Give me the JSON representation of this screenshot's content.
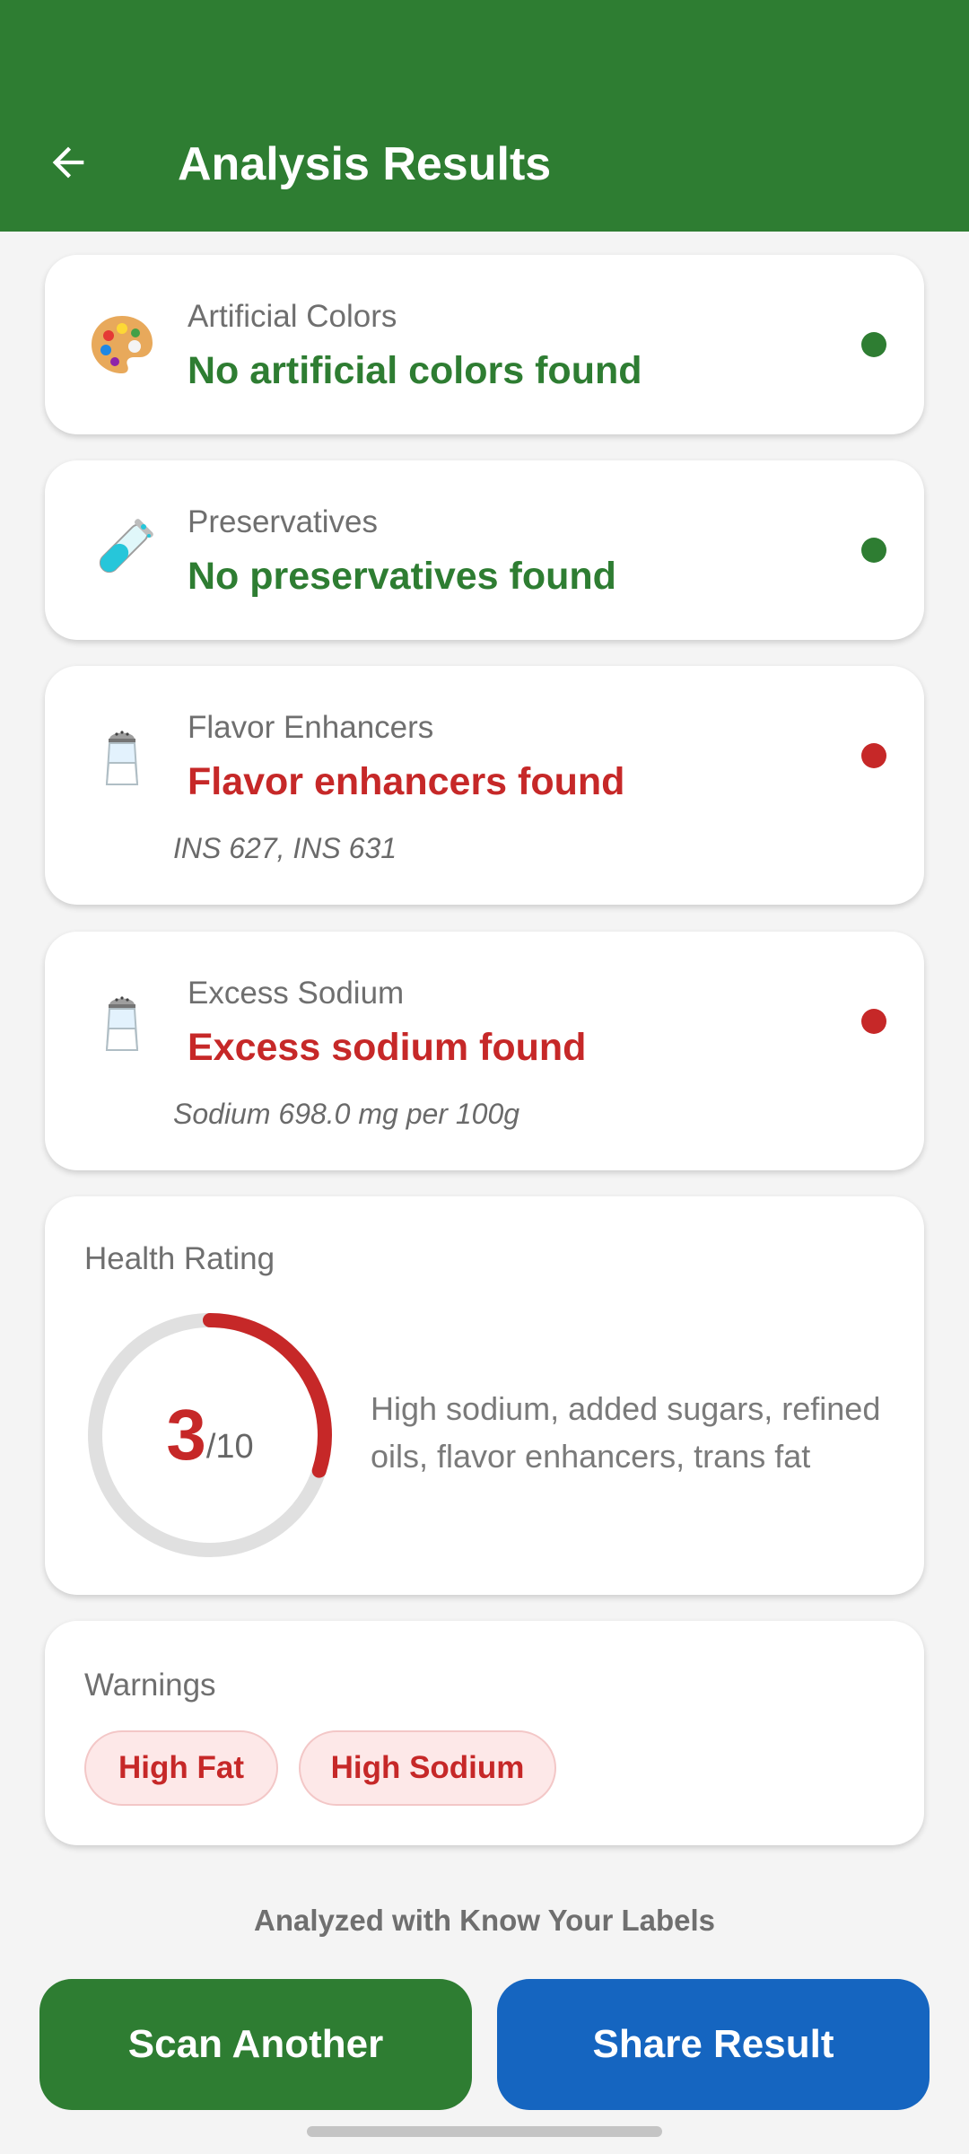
{
  "header": {
    "title": "Analysis Results",
    "back_icon": "arrow-left-icon"
  },
  "colors": {
    "primary": "#2e7d32",
    "danger": "#c62828",
    "secondary": "#1565c0"
  },
  "checks": [
    {
      "label": "Artificial Colors",
      "status": "No artificial colors found",
      "state": "good",
      "icon": "palette-icon",
      "detail": ""
    },
    {
      "label": "Preservatives",
      "status": "No preservatives found",
      "state": "good",
      "icon": "test-tube-icon",
      "detail": ""
    },
    {
      "label": "Flavor Enhancers",
      "status": "Flavor enhancers found",
      "state": "bad",
      "icon": "salt-shaker-icon",
      "detail": "INS 627, INS 631"
    },
    {
      "label": "Excess Sodium",
      "status": "Excess sodium found",
      "state": "bad",
      "icon": "salt-shaker-icon",
      "detail": "Sodium 698.0 mg per 100g"
    }
  ],
  "health_rating": {
    "label": "Health Rating",
    "score": "3",
    "max": "/10",
    "score_value": 3,
    "max_value": 10,
    "description": "High sodium, added sugars, refined oils, flavor enhancers, trans fat"
  },
  "warnings": {
    "label": "Warnings",
    "chips": [
      "High Fat",
      "High Sodium"
    ]
  },
  "footer": {
    "attribution": "Analyzed with Know Your Labels",
    "scan_button": "Scan Another",
    "share_button": "Share Result"
  }
}
